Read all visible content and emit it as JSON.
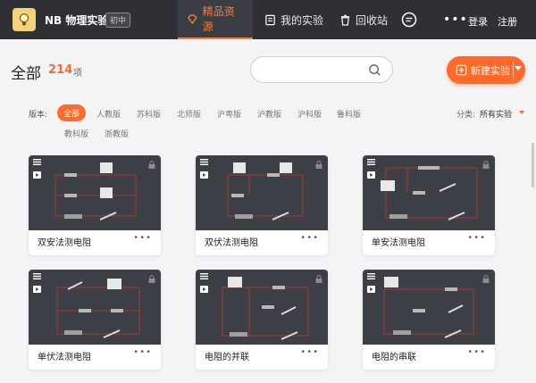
{
  "app": {
    "name": "NB 物理实验",
    "level_badge": "初中"
  },
  "nav": {
    "resources": "精品资源",
    "my_experiments": "我的实验",
    "recycle_bin": "回收站",
    "login": "登录",
    "register": "注册"
  },
  "header": {
    "title": "全部",
    "count": "214",
    "count_unit": "项"
  },
  "search": {
    "placeholder": ""
  },
  "new_experiment_label": "新建实验",
  "filters": {
    "label": "版本:",
    "options": [
      "全部",
      "人教版",
      "苏科版",
      "北师版",
      "沪粤版",
      "沪教版",
      "沪科版",
      "鲁科版",
      "教科版",
      "浙教版"
    ],
    "selected": "全部",
    "sort_label": "分类:",
    "sort_value": "所有实验"
  },
  "cards": [
    {
      "title": "双安法测电阻"
    },
    {
      "title": "双伏法测电阻"
    },
    {
      "title": "单安法测电阻"
    },
    {
      "title": "单伏法测电阻"
    },
    {
      "title": "电阻的并联"
    },
    {
      "title": "电阻的串联"
    }
  ],
  "colors": {
    "accent": "#ff6a2b",
    "topbar": "#2e3036",
    "thumb_bg": "#3d3f46",
    "wire": "#c0392b"
  }
}
